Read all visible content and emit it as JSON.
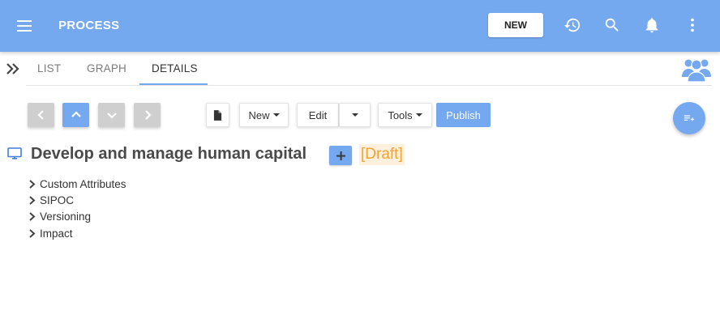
{
  "appbar": {
    "title": "PROCESS",
    "new_label": "NEW",
    "icons": [
      "menu-icon",
      "history-icon",
      "search-icon",
      "bell-icon",
      "more-vert-icon"
    ],
    "color": "#74a8ef"
  },
  "tabs": [
    {
      "label": "LIST",
      "active": false
    },
    {
      "label": "GRAPH",
      "active": false
    },
    {
      "label": "DETAILS",
      "active": true
    }
  ],
  "toolbar": {
    "nav_buttons": [
      "previous",
      "up",
      "down",
      "next"
    ],
    "new_label": "New",
    "edit_label": "Edit",
    "tools_label": "Tools",
    "publish_label": "Publish"
  },
  "content": {
    "title": "Develop and manage human capital",
    "status": "[Draft]",
    "sections": [
      {
        "label": "Custom Attributes"
      },
      {
        "label": "SIPOC"
      },
      {
        "label": "Versioning"
      },
      {
        "label": "Impact"
      }
    ]
  },
  "colors": {
    "accent": "#74a8ef",
    "draft_text": "#f5a233",
    "draft_bg": "#fdf0dc",
    "nav_gray": "#cfcfcf"
  }
}
